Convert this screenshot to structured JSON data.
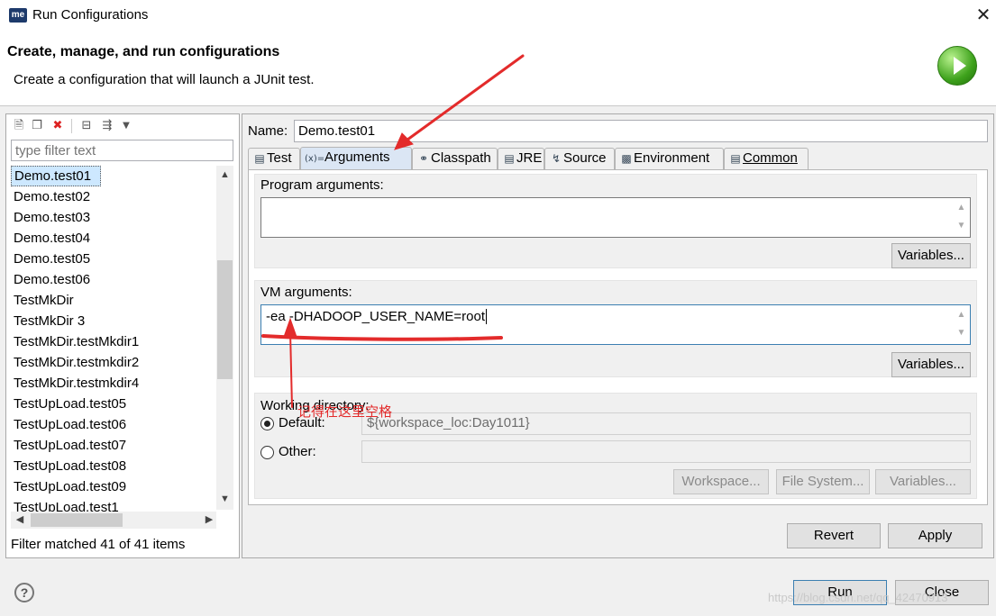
{
  "window": {
    "title": "Run Configurations",
    "logo_text": "me",
    "close_glyph": "✕"
  },
  "header": {
    "title": "Create, manage, and run configurations",
    "subtitle": "Create a configuration that will launch a JUnit test.",
    "icon": "run-icon"
  },
  "left_panel": {
    "toolbar": [
      "new-launch-config-icon",
      "duplicate-icon",
      "delete-icon",
      "collapse-all-icon",
      "filter-icon",
      "dropdown-icon"
    ],
    "filter_placeholder": "type filter text",
    "filter_value": "",
    "configs": [
      "Demo.test01",
      "Demo.test02",
      "Demo.test03",
      "Demo.test04",
      "Demo.test05",
      "Demo.test06",
      "TestMkDir",
      "TestMkDir 3",
      "TestMkDir.testMkdir1",
      "TestMkDir.testmkdir2",
      "TestMkDir.testmkdir4",
      "TestUpLoad.test05",
      "TestUpLoad.test06",
      "TestUpLoad.test07",
      "TestUpLoad.test08",
      "TestUpLoad.test09",
      "TestUpLoad.test1"
    ],
    "selected_config": "Demo.test01",
    "status": "Filter matched 41 of 41 items"
  },
  "right_panel": {
    "name_label": "Name:",
    "name_value": "Demo.test01",
    "tabs": [
      {
        "label": "Test",
        "icon": "test-icon"
      },
      {
        "label": "Arguments",
        "icon": "arguments-icon"
      },
      {
        "label": "Classpath",
        "icon": "classpath-icon"
      },
      {
        "label": "JRE",
        "icon": "jre-icon"
      },
      {
        "label": "Source",
        "icon": "source-icon"
      },
      {
        "label": "Environment",
        "icon": "environment-icon"
      },
      {
        "label": "Common",
        "icon": "common-icon"
      }
    ],
    "active_tab": "Arguments",
    "program_args": {
      "label": "Program arguments:",
      "value": "",
      "variables_button": "Variables..."
    },
    "vm_args": {
      "label": "VM arguments:",
      "value": "-ea -DHADOOP_USER_NAME=root",
      "variables_button": "Variables..."
    },
    "working_dir": {
      "label": "Working directory:",
      "default_label": "Default:",
      "default_value": "${workspace_loc:Day1011}",
      "default_selected": true,
      "other_label": "Other:",
      "other_value": "",
      "buttons": [
        "Workspace...",
        "File System...",
        "Variables..."
      ]
    },
    "revert_button": "Revert",
    "apply_button": "Apply"
  },
  "footer": {
    "help_glyph": "?",
    "run_button": "Run",
    "close_button": "Close",
    "watermark": "https://blog.csdn.net/qq_42470913"
  },
  "annotation": {
    "text": "记得在这里空格",
    "color": "#e32b2b"
  }
}
